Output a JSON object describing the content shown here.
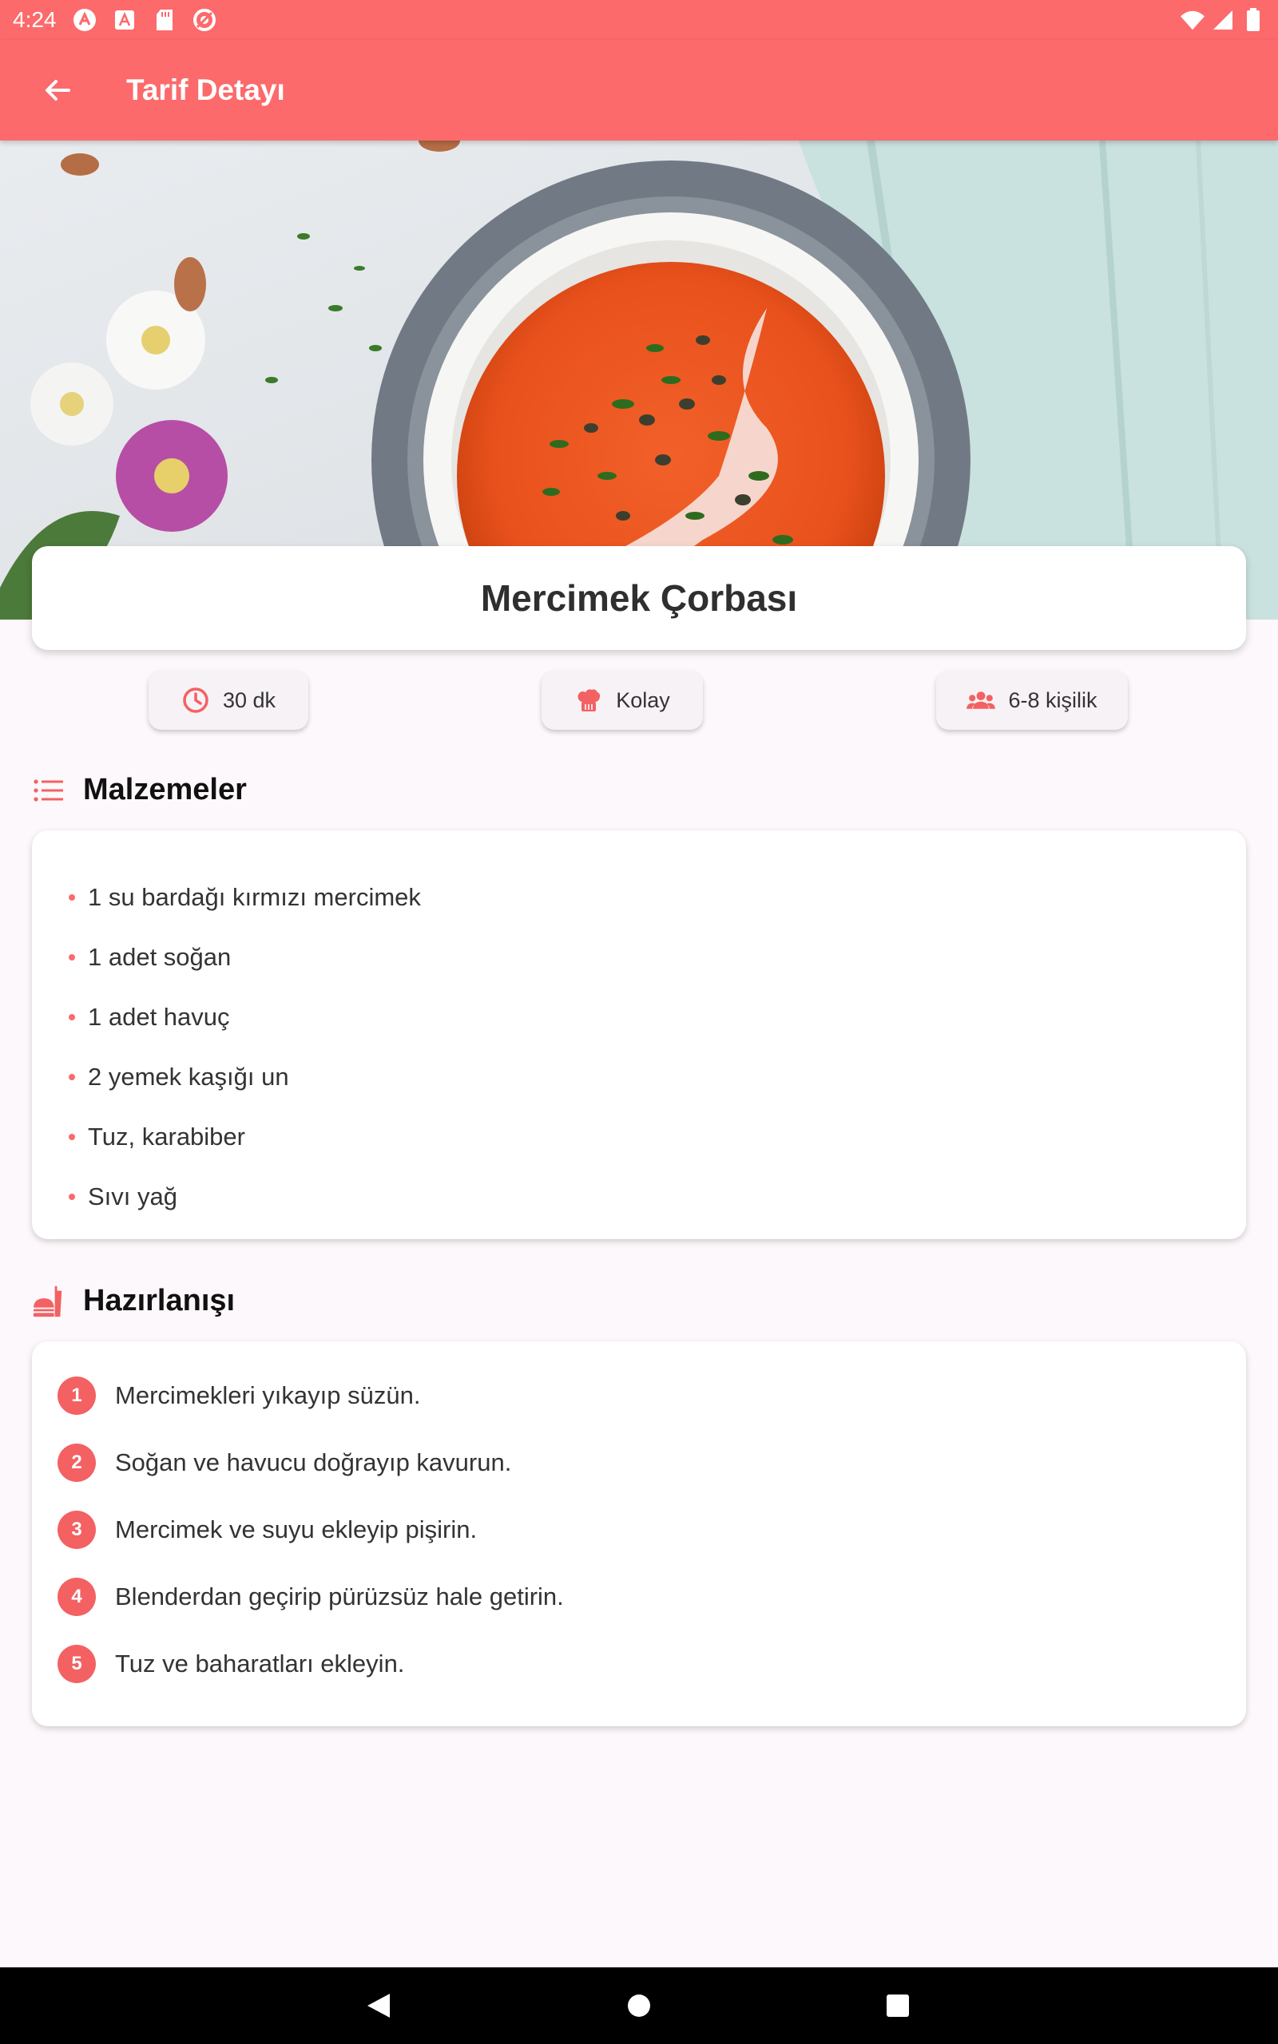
{
  "status_bar": {
    "time": "4:24",
    "icons": [
      "notification-a-icon",
      "font-a-icon",
      "sd-card-icon",
      "sync-icon"
    ],
    "right_icons": [
      "wifi-icon",
      "signal-icon",
      "battery-icon"
    ]
  },
  "app_bar": {
    "title": "Tarif Detayı",
    "back_icon": "arrow-back-icon"
  },
  "hero": {
    "image": "lentil-soup-photo"
  },
  "recipe": {
    "name": "Mercimek Çorbası",
    "time": "30 dk",
    "difficulty": "Kolay",
    "servings": "6-8 kişilik"
  },
  "ingredients": {
    "title": "Malzemeler",
    "items": [
      "1 su bardağı kırmızı mercimek",
      "1 adet soğan",
      "1 adet havuç",
      "2 yemek kaşığı un",
      "Tuz, karabiber",
      "Sıvı yağ"
    ]
  },
  "steps": {
    "title": "Hazırlanışı",
    "items": [
      {
        "num": "1",
        "text": "Mercimekleri yıkayıp süzün."
      },
      {
        "num": "2",
        "text": "Soğan ve havucu doğrayıp kavurun."
      },
      {
        "num": "3",
        "text": "Mercimek ve suyu ekleyip pişirin."
      },
      {
        "num": "4",
        "text": "Blenderdan geçirip pürüzsüz hale getirin."
      },
      {
        "num": "5",
        "text": "Tuz ve baharatları ekleyin."
      }
    ]
  },
  "colors": {
    "accent": "#fc6a6c",
    "step_badge": "#f36163",
    "background": "#fdf8fb"
  }
}
